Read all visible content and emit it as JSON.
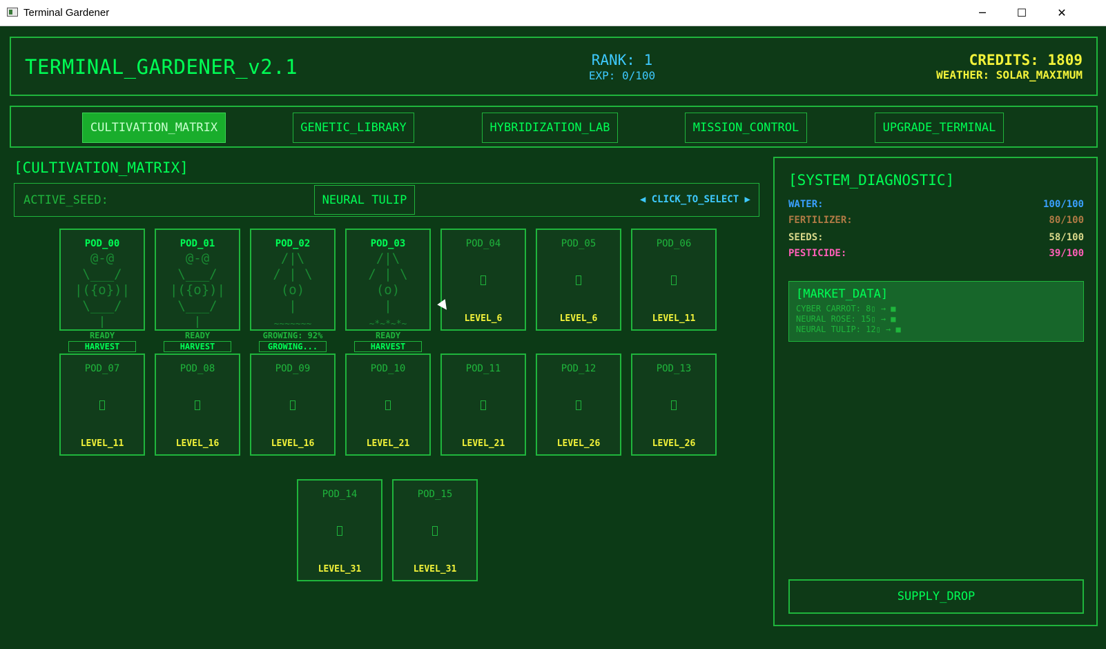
{
  "window": {
    "title": "Terminal Gardener",
    "controls": {
      "minimize": "─",
      "maximize": "☐",
      "close": "✕"
    }
  },
  "header": {
    "app_name": "TERMINAL_GARDENER_v2.1",
    "rank": "RANK: 1",
    "exp": "EXP: 0/100",
    "credits": "CREDITS: 1809",
    "weather": "WEATHER: SOLAR_MAXIMUM"
  },
  "nav": {
    "tabs": [
      {
        "label": "CULTIVATION_MATRIX",
        "active": true
      },
      {
        "label": "GENETIC_LIBRARY",
        "active": false
      },
      {
        "label": "HYBRIDIZATION_LAB",
        "active": false
      },
      {
        "label": "MISSION_CONTROL",
        "active": false
      },
      {
        "label": "UPGRADE_TERMINAL",
        "active": false
      }
    ]
  },
  "cultivation": {
    "title": "[CULTIVATION_MATRIX]",
    "active_seed_label": "ACTIVE_SEED:",
    "active_seed": "NEURAL TULIP",
    "select_hint": "◀ CLICK_TO_SELECT ▶"
  },
  "pods": [
    {
      "name": "POD_00",
      "art": "@-@\n\\___/\n|({o})|\n\\___/\n|",
      "status": "READY",
      "action": "HARVEST"
    },
    {
      "name": "POD_01",
      "art": "@-@\n\\___/\n|({o})|\n\\___/\n|",
      "status": "READY",
      "action": "HARVEST"
    },
    {
      "name": "POD_02",
      "art": "/|\\\n/ | \\\n(o)\n|",
      "ground": "~~~~~~~",
      "status": "GROWING: 92%",
      "action": "GROWING..."
    },
    {
      "name": "POD_03",
      "art": "/|\\\n/ | \\\n(o)\n|",
      "ground": "~*~*~*~",
      "status": "READY",
      "action": "HARVEST"
    },
    {
      "name": "POD_04",
      "level": "LEVEL_6"
    },
    {
      "name": "POD_05",
      "level": "LEVEL_6"
    },
    {
      "name": "POD_06",
      "level": "LEVEL_11"
    },
    {
      "name": "POD_07",
      "level": "LEVEL_11"
    },
    {
      "name": "POD_08",
      "level": "LEVEL_16"
    },
    {
      "name": "POD_09",
      "level": "LEVEL_16"
    },
    {
      "name": "POD_10",
      "level": "LEVEL_21"
    },
    {
      "name": "POD_11",
      "level": "LEVEL_21"
    },
    {
      "name": "POD_12",
      "level": "LEVEL_26"
    },
    {
      "name": "POD_13",
      "level": "LEVEL_26"
    },
    {
      "name": "POD_14",
      "level": "LEVEL_31"
    },
    {
      "name": "POD_15",
      "level": "LEVEL_31"
    }
  ],
  "diagnostic": {
    "title": "[SYSTEM_DIAGNOSTIC]",
    "resources": [
      {
        "label": "WATER:",
        "value": "100/100",
        "color": "#3aa0ff"
      },
      {
        "label": "FERTILIZER:",
        "value": "80/100",
        "color": "#b07a45"
      },
      {
        "label": "SEEDS:",
        "value": "58/100",
        "color": "#d8d88a"
      },
      {
        "label": "PESTICIDE:",
        "value": "39/100",
        "color": "#ff5fb8"
      }
    ],
    "market": {
      "title": "[MARKET_DATA]",
      "rows": [
        "CYBER CARROT: 8▯ → ■",
        "NEURAL ROSE: 15▯ → ■",
        "NEURAL TULIP: 12▯ → ■"
      ]
    },
    "supply_button": "SUPPLY_DROP"
  }
}
